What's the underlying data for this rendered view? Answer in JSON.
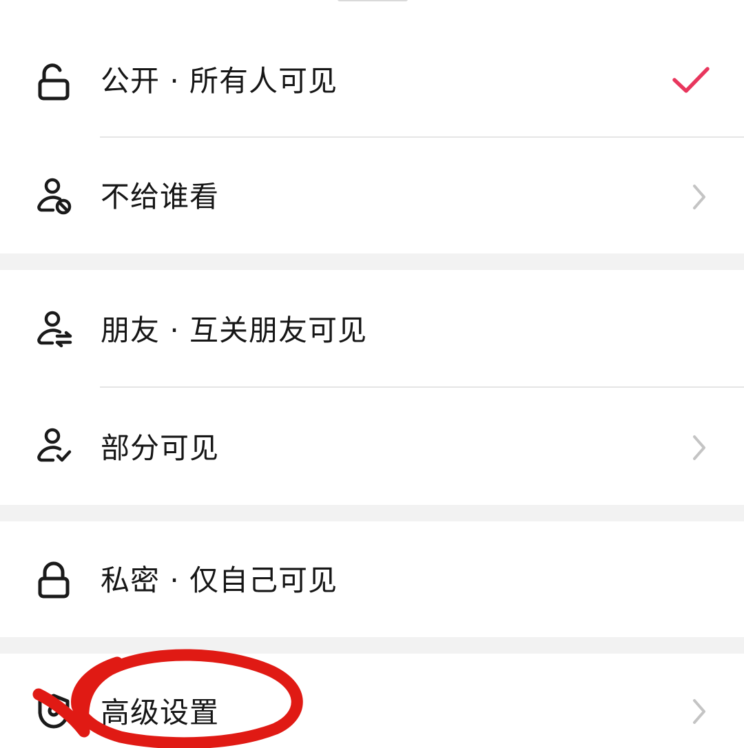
{
  "visibility_sheet": {
    "options": [
      {
        "id": "public",
        "label": "公开 · 所有人可见",
        "icon": "unlocked-padlock-icon",
        "selected": true
      },
      {
        "id": "hide-from",
        "label": "不给谁看",
        "icon": "user-blocked-icon",
        "has_chevron": true
      },
      {
        "id": "friends",
        "label": "朋友 · 互关朋友可见",
        "icon": "user-mutual-icon"
      },
      {
        "id": "partial",
        "label": "部分可见",
        "icon": "user-check-icon",
        "has_chevron": true
      },
      {
        "id": "private",
        "label": "私密 · 仅自己可见",
        "icon": "locked-padlock-icon"
      },
      {
        "id": "advanced",
        "label": "高级设置",
        "icon": "shield-settings-icon",
        "has_chevron": true
      }
    ]
  },
  "colors": {
    "accent_check": "#e8365d",
    "annotation_circle": "#e01a14",
    "chevron": "#c4c4c4",
    "text": "#161616",
    "section_gap": "#f2f2f2"
  }
}
